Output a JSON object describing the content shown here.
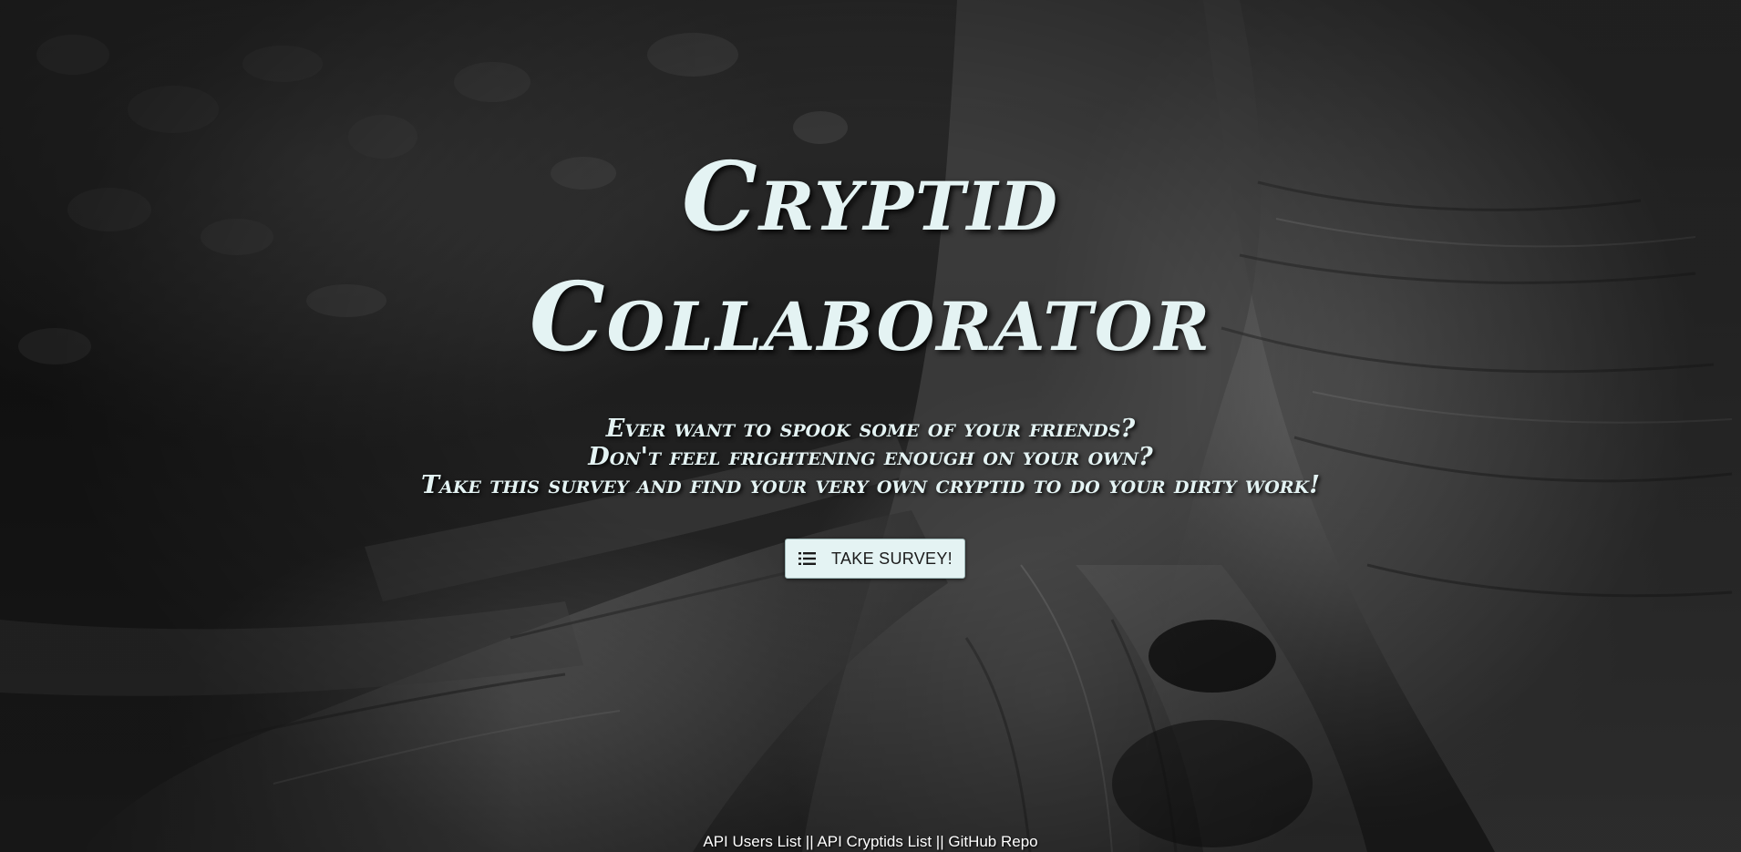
{
  "hero": {
    "title_line1": "Cryptid",
    "title_line2": "Collaborator",
    "tagline_line1": "Ever want to spook some of your friends?",
    "tagline_line2": "Don't feel frightening enough on your own?",
    "tagline_line3": "Take this survey and find your very own cryptid to do your dirty work!"
  },
  "survey_button": {
    "label": "TAKE SURVEY!",
    "icon": "list-icon"
  },
  "footer": {
    "link_users": "API Users List",
    "separator1": " || ",
    "link_cryptids": "API Cryptids List",
    "separator2": " || ",
    "link_repo": "GitHub Repo"
  },
  "colors": {
    "text_primary": "#e4f3f3",
    "button_bg": "#e4f3f3",
    "footer_text": "#ffffff"
  }
}
